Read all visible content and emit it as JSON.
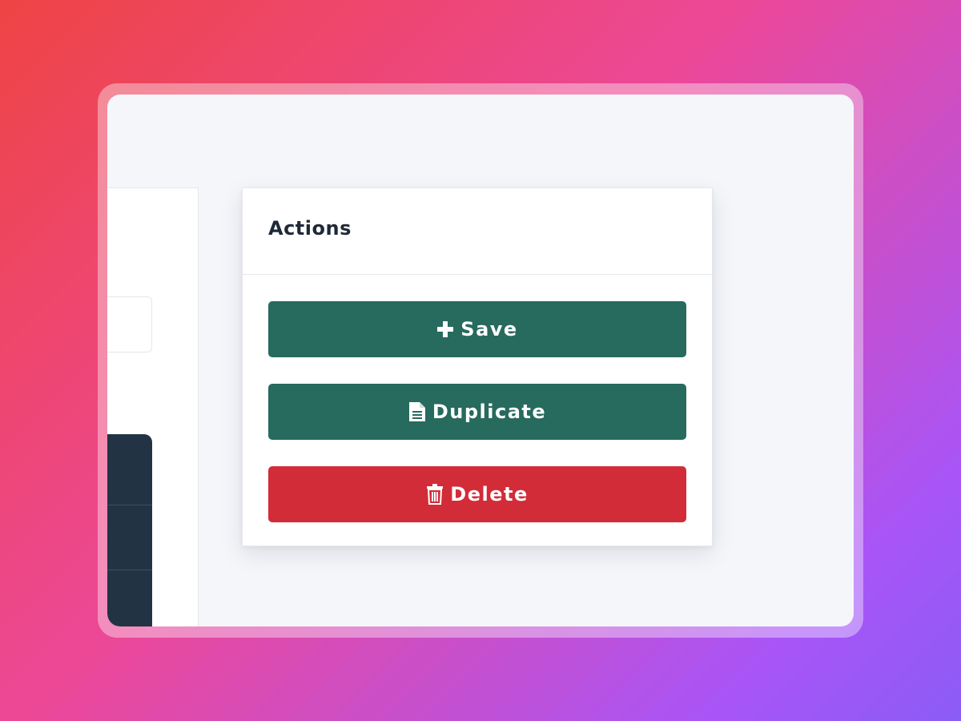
{
  "card": {
    "title": "Actions"
  },
  "actions": [
    {
      "label": "Save",
      "icon": "plus-icon",
      "color": "#276a5e"
    },
    {
      "label": "Duplicate",
      "icon": "document-icon",
      "color": "#276a5e"
    },
    {
      "label": "Delete",
      "icon": "trash-icon",
      "color": "#d22c39"
    }
  ],
  "colors": {
    "primary": "#276a5e",
    "danger": "#d22c39",
    "window_bg": "#f4f6fa",
    "dark_panel": "#223344"
  }
}
